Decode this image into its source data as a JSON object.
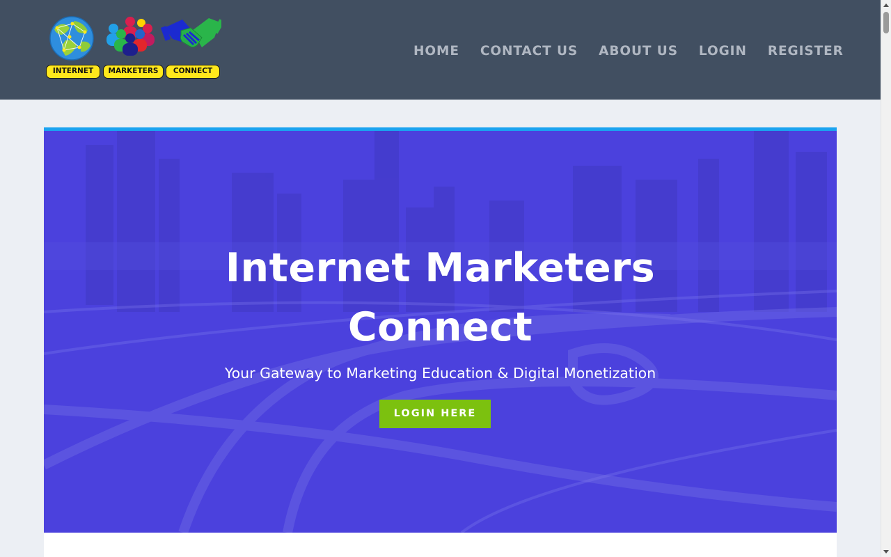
{
  "header": {
    "logo": {
      "pill_labels": [
        "INTERNET",
        "MARKETERS",
        "CONNECT"
      ],
      "icons": [
        "globe-icon",
        "people-group-icon",
        "handshake-icon"
      ]
    },
    "nav": [
      "HOME",
      "CONTACT US",
      "ABOUT US",
      "LOGIN",
      "REGISTER"
    ]
  },
  "hero": {
    "title_line1": "Internet Marketers",
    "title_line2": "Connect",
    "subtitle": "Your Gateway to Marketing Education & Digital Monetization",
    "button_label": "LOGIN HERE",
    "background_image": "city-highway-interchange"
  },
  "colors": {
    "header_bg": "#414f61",
    "page_bg": "#eceff4",
    "hero_overlay": "#4a41d8",
    "hero_top_border": "#1aa3f0",
    "button_bg": "#7cc10f"
  }
}
